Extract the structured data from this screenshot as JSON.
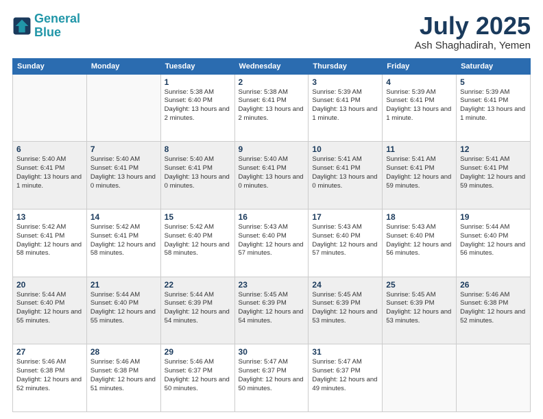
{
  "header": {
    "logo_line1": "General",
    "logo_line2": "Blue",
    "month_year": "July 2025",
    "location": "Ash Shaghadirah, Yemen"
  },
  "days_of_week": [
    "Sunday",
    "Monday",
    "Tuesday",
    "Wednesday",
    "Thursday",
    "Friday",
    "Saturday"
  ],
  "weeks": [
    [
      {
        "day": "",
        "info": ""
      },
      {
        "day": "",
        "info": ""
      },
      {
        "day": "1",
        "info": "Sunrise: 5:38 AM\nSunset: 6:40 PM\nDaylight: 13 hours and 2 minutes."
      },
      {
        "day": "2",
        "info": "Sunrise: 5:38 AM\nSunset: 6:41 PM\nDaylight: 13 hours and 2 minutes."
      },
      {
        "day": "3",
        "info": "Sunrise: 5:39 AM\nSunset: 6:41 PM\nDaylight: 13 hours and 1 minute."
      },
      {
        "day": "4",
        "info": "Sunrise: 5:39 AM\nSunset: 6:41 PM\nDaylight: 13 hours and 1 minute."
      },
      {
        "day": "5",
        "info": "Sunrise: 5:39 AM\nSunset: 6:41 PM\nDaylight: 13 hours and 1 minute."
      }
    ],
    [
      {
        "day": "6",
        "info": "Sunrise: 5:40 AM\nSunset: 6:41 PM\nDaylight: 13 hours and 1 minute."
      },
      {
        "day": "7",
        "info": "Sunrise: 5:40 AM\nSunset: 6:41 PM\nDaylight: 13 hours and 0 minutes."
      },
      {
        "day": "8",
        "info": "Sunrise: 5:40 AM\nSunset: 6:41 PM\nDaylight: 13 hours and 0 minutes."
      },
      {
        "day": "9",
        "info": "Sunrise: 5:40 AM\nSunset: 6:41 PM\nDaylight: 13 hours and 0 minutes."
      },
      {
        "day": "10",
        "info": "Sunrise: 5:41 AM\nSunset: 6:41 PM\nDaylight: 13 hours and 0 minutes."
      },
      {
        "day": "11",
        "info": "Sunrise: 5:41 AM\nSunset: 6:41 PM\nDaylight: 12 hours and 59 minutes."
      },
      {
        "day": "12",
        "info": "Sunrise: 5:41 AM\nSunset: 6:41 PM\nDaylight: 12 hours and 59 minutes."
      }
    ],
    [
      {
        "day": "13",
        "info": "Sunrise: 5:42 AM\nSunset: 6:41 PM\nDaylight: 12 hours and 58 minutes."
      },
      {
        "day": "14",
        "info": "Sunrise: 5:42 AM\nSunset: 6:41 PM\nDaylight: 12 hours and 58 minutes."
      },
      {
        "day": "15",
        "info": "Sunrise: 5:42 AM\nSunset: 6:40 PM\nDaylight: 12 hours and 58 minutes."
      },
      {
        "day": "16",
        "info": "Sunrise: 5:43 AM\nSunset: 6:40 PM\nDaylight: 12 hours and 57 minutes."
      },
      {
        "day": "17",
        "info": "Sunrise: 5:43 AM\nSunset: 6:40 PM\nDaylight: 12 hours and 57 minutes."
      },
      {
        "day": "18",
        "info": "Sunrise: 5:43 AM\nSunset: 6:40 PM\nDaylight: 12 hours and 56 minutes."
      },
      {
        "day": "19",
        "info": "Sunrise: 5:44 AM\nSunset: 6:40 PM\nDaylight: 12 hours and 56 minutes."
      }
    ],
    [
      {
        "day": "20",
        "info": "Sunrise: 5:44 AM\nSunset: 6:40 PM\nDaylight: 12 hours and 55 minutes."
      },
      {
        "day": "21",
        "info": "Sunrise: 5:44 AM\nSunset: 6:40 PM\nDaylight: 12 hours and 55 minutes."
      },
      {
        "day": "22",
        "info": "Sunrise: 5:44 AM\nSunset: 6:39 PM\nDaylight: 12 hours and 54 minutes."
      },
      {
        "day": "23",
        "info": "Sunrise: 5:45 AM\nSunset: 6:39 PM\nDaylight: 12 hours and 54 minutes."
      },
      {
        "day": "24",
        "info": "Sunrise: 5:45 AM\nSunset: 6:39 PM\nDaylight: 12 hours and 53 minutes."
      },
      {
        "day": "25",
        "info": "Sunrise: 5:45 AM\nSunset: 6:39 PM\nDaylight: 12 hours and 53 minutes."
      },
      {
        "day": "26",
        "info": "Sunrise: 5:46 AM\nSunset: 6:38 PM\nDaylight: 12 hours and 52 minutes."
      }
    ],
    [
      {
        "day": "27",
        "info": "Sunrise: 5:46 AM\nSunset: 6:38 PM\nDaylight: 12 hours and 52 minutes."
      },
      {
        "day": "28",
        "info": "Sunrise: 5:46 AM\nSunset: 6:38 PM\nDaylight: 12 hours and 51 minutes."
      },
      {
        "day": "29",
        "info": "Sunrise: 5:46 AM\nSunset: 6:37 PM\nDaylight: 12 hours and 50 minutes."
      },
      {
        "day": "30",
        "info": "Sunrise: 5:47 AM\nSunset: 6:37 PM\nDaylight: 12 hours and 50 minutes."
      },
      {
        "day": "31",
        "info": "Sunrise: 5:47 AM\nSunset: 6:37 PM\nDaylight: 12 hours and 49 minutes."
      },
      {
        "day": "",
        "info": ""
      },
      {
        "day": "",
        "info": ""
      }
    ]
  ]
}
